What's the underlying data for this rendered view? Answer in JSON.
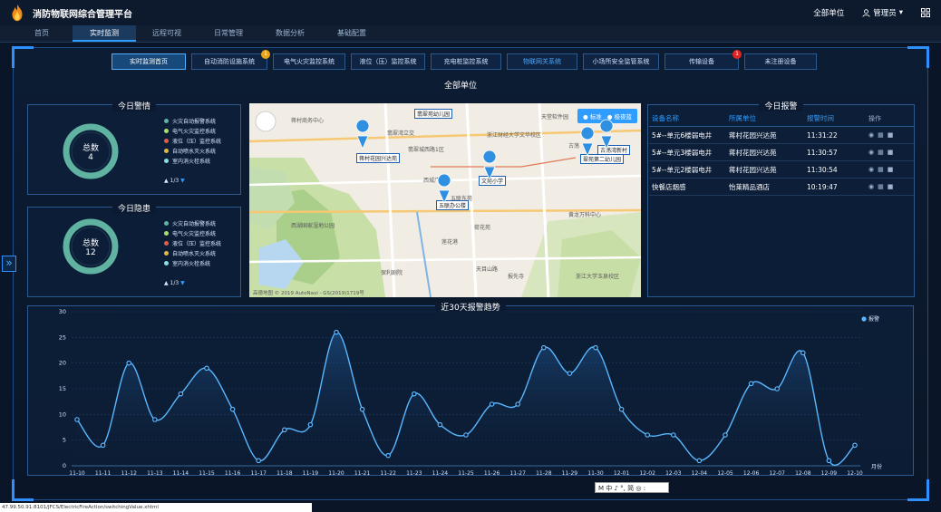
{
  "app": {
    "title": "消防物联网综合管理平台"
  },
  "header": {
    "unit_selector": "全部单位",
    "user": "管理员"
  },
  "nav": [
    "首页",
    "实时监测",
    "远程可视",
    "日常管理",
    "数据分析",
    "基础配置"
  ],
  "system_tabs": [
    {
      "label": "实时监测首页",
      "badge": ""
    },
    {
      "label": "自动消防设施系统",
      "badge": "1"
    },
    {
      "label": "电气火灾监控系统",
      "badge": ""
    },
    {
      "label": "液位（压）监控系统",
      "badge": ""
    },
    {
      "label": "充电桩监控系统",
      "badge": ""
    },
    {
      "label": "物联网关系统",
      "badge": ""
    },
    {
      "label": "小场所安全监管系统",
      "badge": ""
    },
    {
      "label": "传输设备",
      "badge": "1"
    },
    {
      "label": "未注册设备",
      "badge": ""
    }
  ],
  "section_title": "全部单位",
  "today_alarm": {
    "title": "今日警情",
    "total_label": "总数",
    "total": "4",
    "legend": [
      "火灾自动报警系统",
      "电气火灾监控系统",
      "液位（压）监控系统",
      "自动喷水灭火系统",
      "室内消火栓系统"
    ],
    "legend_colors": [
      "#5fb3a0",
      "#a8e06b",
      "#e65a4c",
      "#e2b740",
      "#8de0e0"
    ],
    "pager": "1/3"
  },
  "today_hazard": {
    "title": "今日隐患",
    "total_label": "总数",
    "total": "12",
    "legend": [
      "火灾自动报警系统",
      "电气火灾监控系统",
      "液位（压）监控系统",
      "自动喷水灭火系统",
      "室内消火栓系统"
    ],
    "legend_colors": [
      "#5fb3a0",
      "#a8e06b",
      "#e65a4c",
      "#e2b740",
      "#8de0e0"
    ],
    "pager": "1/3"
  },
  "map": {
    "toggle_standard": "标准",
    "toggle_night": "极夜蓝",
    "attribution": "高德地图 © 2019 AutoNavi - GS(2019)1719号",
    "markers": [
      "翡翠苑幼儿园",
      "蒋村花园兴达苑",
      "文苑小学",
      "五联办公楼",
      "古荡湾新村",
      "翠苑第二幼儿园"
    ],
    "places": [
      "蒋村商务中心",
      "翡翠湾立交",
      "翡翠城西路1区",
      "西城广场",
      "五联东苑",
      "浙江财经大学文华校区",
      "天堂软件园",
      "古荡",
      "西湖国家湿地公园",
      "莲花港",
      "荷花苑",
      "保利剧院",
      "天目山路",
      "报先寺",
      "浙江大学玉泉校区",
      "黄龙万科中心"
    ]
  },
  "today_report": {
    "title": "今日报警",
    "headers": [
      "设备名称",
      "所属单位",
      "报警时间",
      "操作"
    ],
    "rows": [
      [
        "5#--单元6楼弱电井",
        "蒋村花园兴达苑",
        "11:31:22"
      ],
      [
        "5#--单元3楼弱电井",
        "蒋村花园兴达苑",
        "11:30:57"
      ],
      [
        "5#--单元2楼弱电井",
        "蒋村花园兴达苑",
        "11:30:54"
      ],
      [
        "快餐店烟感",
        "怡莱精品酒店",
        "10:19:47"
      ]
    ]
  },
  "chart_data": {
    "type": "line",
    "title": "近30天报警趋势",
    "xlabel": "月份",
    "ylabel": "",
    "ylim": [
      0,
      30
    ],
    "yticks": [
      0,
      5,
      10,
      15,
      20,
      25,
      30
    ],
    "legend_position": "top-right",
    "categories": [
      "11-10",
      "11-11",
      "11-12",
      "11-13",
      "11-14",
      "11-15",
      "11-16",
      "11-17",
      "11-18",
      "11-19",
      "11-20",
      "11-21",
      "11-22",
      "11-23",
      "11-24",
      "11-25",
      "11-26",
      "11-27",
      "11-28",
      "11-29",
      "11-30",
      "12-01",
      "12-02",
      "12-03",
      "12-04",
      "12-05",
      "12-06",
      "12-07",
      "12-08",
      "12-09",
      "12-10"
    ],
    "series": [
      {
        "name": "报警",
        "values": [
          9,
          4,
          20,
          9,
          14,
          19,
          11,
          1,
          7,
          8,
          26,
          11,
          2,
          14,
          8,
          6,
          12,
          12,
          23,
          18,
          23,
          11,
          6,
          6,
          1,
          6,
          16,
          15,
          22,
          1,
          4
        ]
      }
    ],
    "color": "#5ab7ff"
  },
  "status_url": "47.99.50.91:8101/JFCS/ElectricFireAction/switchingValue.xhtml",
  "ime": "M 中 ♪ °, 简 ◎ :"
}
